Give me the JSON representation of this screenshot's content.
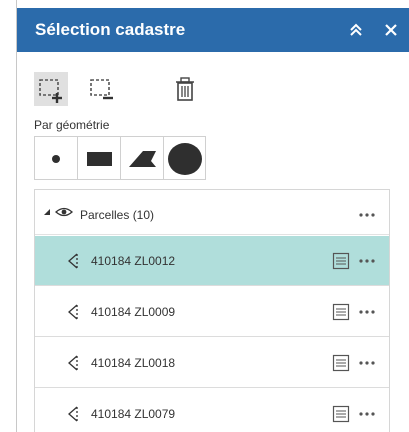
{
  "header": {
    "title": "Sélection cadastre",
    "background": "#2b6bab"
  },
  "toolbar": {
    "draw_icon": "select-add-icon",
    "erase_icon": "select-remove-icon",
    "clear_icon": "trash-icon"
  },
  "geometry": {
    "label": "Par géométrie",
    "shapes": [
      "point",
      "rectangle",
      "polygon",
      "circle"
    ]
  },
  "tree": {
    "group": {
      "label": "Parcelles (10)",
      "expanded": true
    },
    "rows": [
      {
        "label": "410184 ZL0012",
        "selected": true
      },
      {
        "label": "410184 ZL0009",
        "selected": false
      },
      {
        "label": "410184 ZL0018",
        "selected": false
      },
      {
        "label": "410184 ZL0079",
        "selected": false
      }
    ],
    "selected_color": "#b0dedb"
  }
}
